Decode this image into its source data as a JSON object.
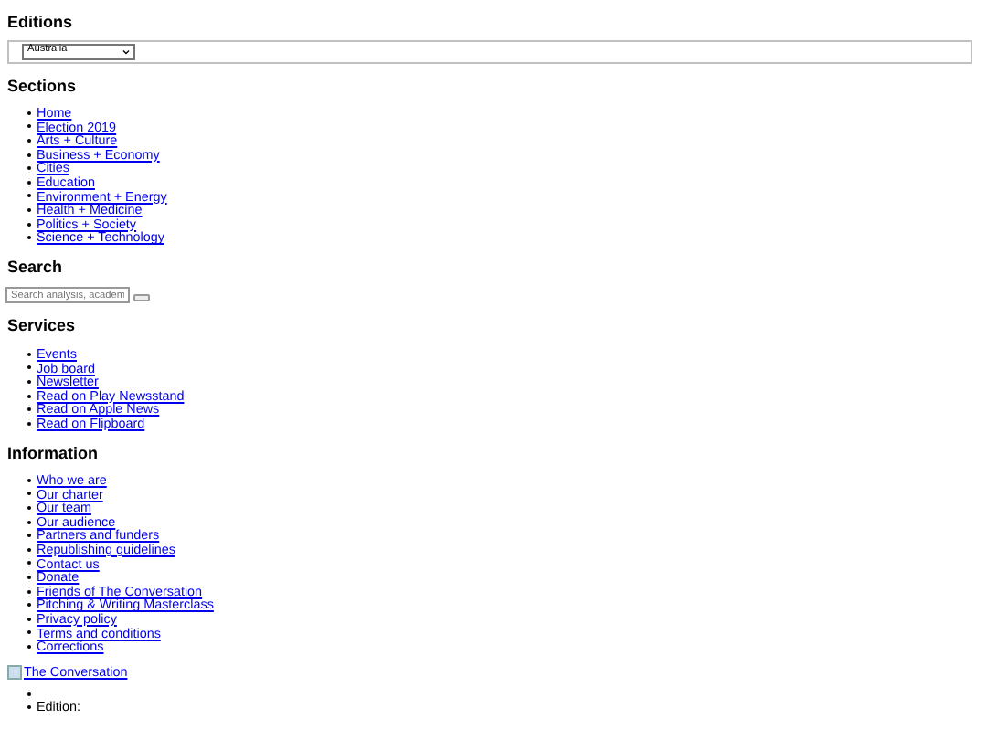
{
  "editions": {
    "heading": "Editions",
    "select_value": "Australia"
  },
  "sections": {
    "heading": "Sections",
    "links": [
      "Home",
      "Election 2019",
      "Arts + Culture",
      "Business + Economy",
      "Cities",
      "Education",
      "Environment + Energy",
      "Health + Medicine",
      "Politics + Society",
      "Science + Technology"
    ]
  },
  "search": {
    "heading": "Search",
    "placeholder": "Search analysis, academ"
  },
  "services": {
    "heading": "Services",
    "links": [
      "Events",
      "Job board",
      "Newsletter",
      "Read on Play Newsstand",
      "Read on Apple News",
      "Read on Flipboard"
    ]
  },
  "information": {
    "heading": "Information",
    "links": [
      "Who we are",
      "Our charter",
      "Our team",
      "Our audience",
      "Partners and funders",
      "Republishing guidelines",
      "Contact us",
      "Donate",
      "Friends of The Conversation",
      "Pitching & Writing Masterclass",
      "Privacy policy",
      "Terms and conditions",
      "Corrections"
    ]
  },
  "logo_link": {
    "text": "The Conversation"
  },
  "edition_menu": [
    {
      "kind": "empty"
    },
    {
      "kind": "label",
      "text": "Edition:"
    }
  ]
}
